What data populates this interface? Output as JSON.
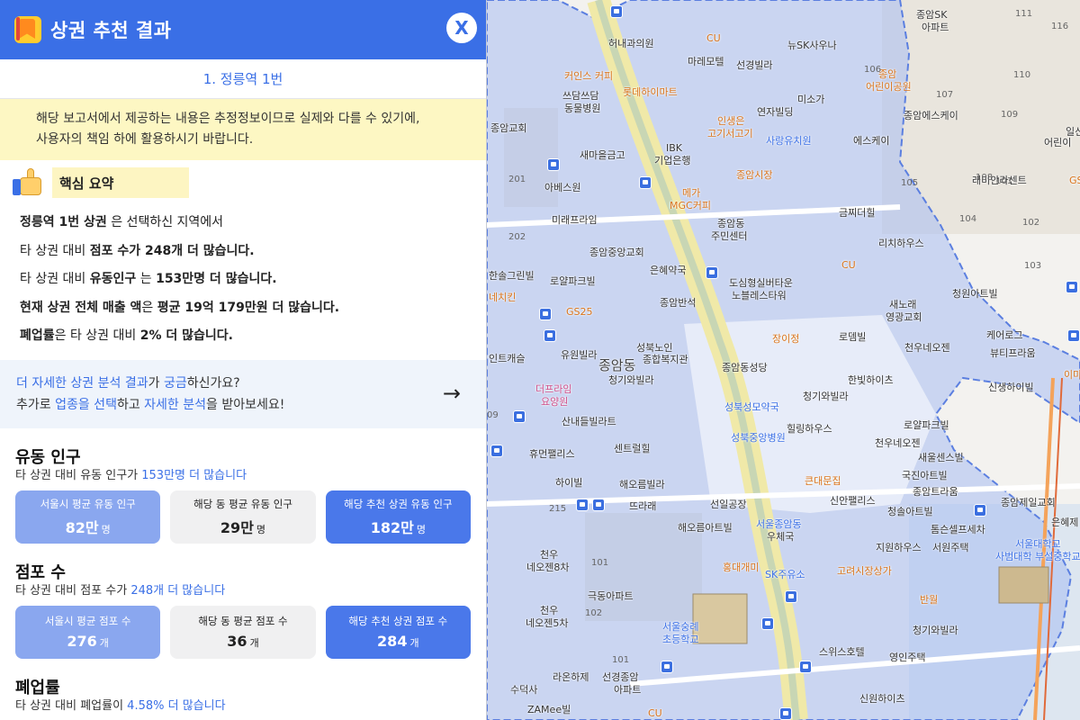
{
  "header": {
    "title": "상권 추천 결과",
    "close_label": "X"
  },
  "location": {
    "label": "1. 정릉역 1번"
  },
  "notice": {
    "line1": "해당 보고서에서 제공하는 내용은 추정정보이므로 실제와 다를 수 있기에,",
    "line2": "사용자의 책임 하에 활용하시기 바랍니다."
  },
  "summary": {
    "heading": "핵심 요약",
    "l1_bold": "정릉역 1번 상권",
    "l1_rest": " 은 선택하신 지역에서",
    "l2_pre": "타 상권 대비 ",
    "l2_bold": "점포 수가 248개 더 많습니다.",
    "l3_pre": "타 상권 대비 ",
    "l3_bold1": "유동인구",
    "l3_mid": " 는 ",
    "l3_bold2": "153만명 더 많습니다.",
    "l4_bold1": "현재 상권 전체 매출 액",
    "l4_mid": "은 ",
    "l4_bold2": "평균 19억 179만원 더 많습니다.",
    "l5_bold1": "폐업률",
    "l5_mid": "은 타 상권 대비 ",
    "l5_bold2": "2% 더 많습니다."
  },
  "cta": {
    "a1": "더 자세한 상권 분석 결과",
    "a2": "가 ",
    "a3": "궁금",
    "a4": "하신가요?",
    "b1": "추가로 ",
    "b2": "업종을 선택",
    "b3": "하고 ",
    "b4": "자세한 분석",
    "b5": "을 받아보세요!",
    "arrow": "→"
  },
  "foot_traffic": {
    "title": "유동 인구",
    "sub_pre": "타 상권 대비 유동 인구가 ",
    "sub_highlight": "153만명 더 많습니다",
    "cards": [
      {
        "label": "서울시 평균 유동 인구",
        "value": "82만",
        "unit": "명"
      },
      {
        "label": "해당 동 평균 유동 인구",
        "value": "29만",
        "unit": "명"
      },
      {
        "label": "해당 추천 상권 유동 인구",
        "value": "182만",
        "unit": "명"
      }
    ]
  },
  "stores": {
    "title": "점포 수",
    "sub_pre": "타 상권 대비 점포 수가 ",
    "sub_highlight": "248개 더 많습니다",
    "cards": [
      {
        "label": "서울시 평균 점포 수",
        "value": "276",
        "unit": "개"
      },
      {
        "label": "해당 동 평균 점포 수",
        "value": "36",
        "unit": "개"
      },
      {
        "label": "해당 추천 상권 점포 수",
        "value": "284",
        "unit": "개"
      }
    ]
  },
  "closure": {
    "title": "폐업률",
    "sub_pre": "타 상권 대비 폐업률이 ",
    "sub_highlight": "4.58% 더 많습니다"
  },
  "map": {
    "labels": [
      {
        "t": "허내과의원",
        "c": "n"
      },
      {
        "t": "CU",
        "c": "o"
      },
      {
        "t": "뉴SK사우나",
        "c": "n"
      },
      {
        "t": "종암SK",
        "c": "n"
      },
      {
        "t": "아파트",
        "c": "n"
      },
      {
        "t": "마레모텔",
        "c": "n"
      },
      {
        "t": "선경빌라",
        "c": "n"
      },
      {
        "t": "커인스 커피",
        "c": "o"
      },
      {
        "t": "롯데하이마트",
        "c": "o"
      },
      {
        "t": "종암",
        "c": "o"
      },
      {
        "t": "어린이공원",
        "c": "o"
      },
      {
        "t": "쓰담쓰담",
        "c": "n"
      },
      {
        "t": "동물병원",
        "c": "n"
      },
      {
        "t": "미소가",
        "c": "n"
      },
      {
        "t": "연자빌딩",
        "c": "n"
      },
      {
        "t": "종암에스케이",
        "c": "n"
      },
      {
        "t": "종암교회",
        "c": "n"
      },
      {
        "t": "인생은",
        "c": "o"
      },
      {
        "t": "고기서고기",
        "c": "o"
      },
      {
        "t": "사랑유치원",
        "c": "b"
      },
      {
        "t": "에스케이",
        "c": "n"
      },
      {
        "t": "IBK",
        "c": "n"
      },
      {
        "t": "기업은행",
        "c": "n"
      },
      {
        "t": "새마을금고",
        "c": "n"
      },
      {
        "t": "종암시장",
        "c": "o"
      },
      {
        "t": "래미안라센트",
        "c": "n"
      },
      {
        "t": "아베스원",
        "c": "n"
      },
      {
        "t": "메가",
        "c": "o"
      },
      {
        "t": "MGC커피",
        "c": "o"
      },
      {
        "t": "금찌더힐",
        "c": "n"
      },
      {
        "t": "미래프라임",
        "c": "n"
      },
      {
        "t": "종암동",
        "c": "n"
      },
      {
        "t": "주민센터",
        "c": "n"
      },
      {
        "t": "종암중앙교회",
        "c": "n"
      },
      {
        "t": "리치하우스",
        "c": "n"
      },
      {
        "t": "은혜약국",
        "c": "n"
      },
      {
        "t": "한솔그린빌",
        "c": "n"
      },
      {
        "t": "로얄파크빌",
        "c": "n"
      },
      {
        "t": "도심형실버타운",
        "c": "n"
      },
      {
        "t": "노블레스타워",
        "c": "n"
      },
      {
        "t": "청원아트빌",
        "c": "n"
      },
      {
        "t": "네치킨",
        "c": "o"
      },
      {
        "t": "GS25",
        "c": "o"
      },
      {
        "t": "종암반석",
        "c": "n"
      },
      {
        "t": "새노래",
        "c": "n"
      },
      {
        "t": "영광교회",
        "c": "n"
      },
      {
        "t": "장이정",
        "c": "o"
      },
      {
        "t": "로뎀빌",
        "c": "n"
      },
      {
        "t": "케어로그",
        "c": "n"
      },
      {
        "t": "뷰티프라움",
        "c": "n"
      },
      {
        "t": "천우네오젠",
        "c": "n"
      },
      {
        "t": "유원빌라",
        "c": "n"
      },
      {
        "t": "성북노인",
        "c": "n"
      },
      {
        "t": "종합복지관",
        "c": "n"
      },
      {
        "t": "종암동성당",
        "c": "n"
      },
      {
        "t": "인트캐슬",
        "c": "n"
      },
      {
        "t": "종암동",
        "c": "big"
      },
      {
        "t": "청기와빌라",
        "c": "n"
      },
      {
        "t": "한빛하이츠",
        "c": "n"
      },
      {
        "t": "신생하이빌",
        "c": "n"
      },
      {
        "t": "더프라임",
        "c": "p"
      },
      {
        "t": "요양원",
        "c": "p"
      },
      {
        "t": "청기와빌라",
        "c": "n"
      },
      {
        "t": "성북성모약국",
        "c": "b"
      },
      {
        "t": "힐링하우스",
        "c": "n"
      },
      {
        "t": "산내들빌라트",
        "c": "n"
      },
      {
        "t": "로얄파크빌",
        "c": "n"
      },
      {
        "t": "성북중앙병원",
        "c": "b"
      },
      {
        "t": "천우네오젠",
        "c": "n"
      },
      {
        "t": "휴먼팰리스",
        "c": "n"
      },
      {
        "t": "센트럴힐",
        "c": "n"
      },
      {
        "t": "새울센스빌",
        "c": "n"
      },
      {
        "t": "큰대문집",
        "c": "o"
      },
      {
        "t": "국진아트빌",
        "c": "n"
      },
      {
        "t": "하이빌",
        "c": "n"
      },
      {
        "t": "해오름빌라",
        "c": "n"
      },
      {
        "t": "종암트라움",
        "c": "n"
      },
      {
        "t": "종암제일교회",
        "c": "n"
      },
      {
        "t": "뜨라래",
        "c": "n"
      },
      {
        "t": "선일공장",
        "c": "n"
      },
      {
        "t": "신안팰리스",
        "c": "n"
      },
      {
        "t": "청솔아트빌",
        "c": "n"
      },
      {
        "t": "톰슨셀프세차",
        "c": "n"
      },
      {
        "t": "해오름아트빌",
        "c": "n"
      },
      {
        "t": "서울종암동",
        "c": "b"
      },
      {
        "t": "우체국",
        "c": "n"
      },
      {
        "t": "천우",
        "c": "n"
      },
      {
        "t": "네오젠8차",
        "c": "n"
      },
      {
        "t": "지원하우스",
        "c": "n"
      },
      {
        "t": "서원주택",
        "c": "n"
      },
      {
        "t": "서울대학교",
        "c": "b"
      },
      {
        "t": "사범대학 부설중학교",
        "c": "b"
      },
      {
        "t": "홍대개미",
        "c": "o"
      },
      {
        "t": "SK주유소",
        "c": "b"
      },
      {
        "t": "고려시장상가",
        "c": "o"
      },
      {
        "t": "극동아파트",
        "c": "n"
      },
      {
        "t": "반월",
        "c": "o"
      },
      {
        "t": "천우",
        "c": "n"
      },
      {
        "t": "네오젠5차",
        "c": "n"
      },
      {
        "t": "서울숭례",
        "c": "b"
      },
      {
        "t": "초등학교",
        "c": "b"
      },
      {
        "t": "청기와빌라",
        "c": "n"
      },
      {
        "t": "스위스호텔",
        "c": "n"
      },
      {
        "t": "영인주택",
        "c": "n"
      },
      {
        "t": "라온하제",
        "c": "n"
      },
      {
        "t": "선경종암",
        "c": "n"
      },
      {
        "t": "아파트",
        "c": "n"
      },
      {
        "t": "수덕사",
        "c": "n"
      },
      {
        "t": "ZAMee빌",
        "c": "n"
      },
      {
        "t": "신원하이츠",
        "c": "n"
      },
      {
        "t": "CU",
        "c": "o"
      },
      {
        "t": "CU",
        "c": "o"
      },
      {
        "t": "이마",
        "c": "o"
      },
      {
        "t": "은혜제",
        "c": "n"
      },
      {
        "t": "일신",
        "c": "n"
      },
      {
        "t": "어린이",
        "c": "n"
      },
      {
        "t": "GS",
        "c": "o"
      }
    ],
    "numbers": [
      "111",
      "116",
      "110",
      "106",
      "107",
      "109",
      "105",
      "108",
      "104",
      "103",
      "102",
      "101",
      "201",
      "202",
      "215",
      "101",
      "102",
      "101",
      "09"
    ]
  }
}
